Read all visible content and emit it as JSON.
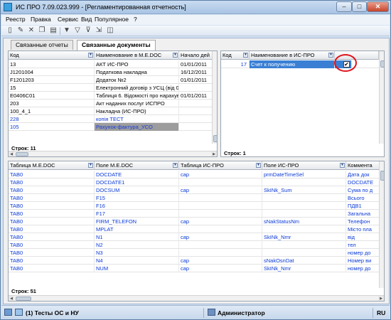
{
  "window": {
    "title": "ИС ПРО 7.09.023.999 - [Регламентированная отчетность]",
    "min_glyph": "–",
    "max_glyph": "□",
    "close_glyph": "✕"
  },
  "menu": [
    "Реестр",
    "Правка",
    "Сервис",
    "Вид",
    "Популярное",
    "?"
  ],
  "toolbar_icons": [
    "new-doc-icon",
    "edit-icon",
    "delete-icon",
    "copy-icon",
    "print-icon",
    "filter-icon",
    "filter-add-icon",
    "filter-remove-icon",
    "export-icon",
    "report-icon"
  ],
  "tabs": [
    {
      "label": "Связанные отчеты",
      "active": false
    },
    {
      "label": "Связанные документы",
      "active": true
    }
  ],
  "top_left_table": {
    "columns": [
      "Код",
      "Наименование в M.E.DOC",
      "Начало дей"
    ],
    "rows": [
      {
        "code": "13",
        "name": "АКТ ИС-ПРО",
        "start": "01/01/2011",
        "style": ""
      },
      {
        "code": "J1201004",
        "name": "Податкова накладна",
        "start": "16/12/2011",
        "style": ""
      },
      {
        "code": "F1201203",
        "name": "Додаток №2",
        "start": "01/01/2011",
        "style": ""
      },
      {
        "code": "15",
        "name": "Електронний договір з УСЦ (від 0...",
        "start": "",
        "style": ""
      },
      {
        "code": "E0406C01",
        "name": "Таблиця 6. Відомості про нарахув...",
        "start": "01/01/2011",
        "style": ""
      },
      {
        "code": "203",
        "name": "Акт наданих послуг ИСПРО",
        "start": "",
        "style": ""
      },
      {
        "code": "100_4_1",
        "name": "Накладна (ИС-ПРО)",
        "start": "",
        "style": ""
      },
      {
        "code": "228",
        "name": "копія ТЕСТ",
        "start": "",
        "style": "blue"
      },
      {
        "code": "105",
        "name": "Рахунок-фактура_УСО",
        "start": "",
        "style": "selected"
      }
    ],
    "footer": "Строк: 11"
  },
  "top_right_table": {
    "columns": [
      "Код",
      "Наименование в ИС-ПРО",
      ""
    ],
    "rows": [
      {
        "code": "17",
        "name": "Счет к получению",
        "checked": true,
        "check_glyph": "✔"
      }
    ],
    "footer": "Строк: 1"
  },
  "bottom_table": {
    "columns": [
      "Таблица M.E.DOC",
      "Поле M.E.DOC",
      "Таблица ИС-ПРО",
      "Поле ИС-ПРО",
      "Коммента"
    ],
    "rows": [
      {
        "t1": "TAB0",
        "f1": "DOCDATE",
        "t2": "cap",
        "f2": "prmDateTimeSel",
        "c": "Дата док"
      },
      {
        "t1": "TAB0",
        "f1": "DOCDATE1",
        "t2": "",
        "f2": "",
        "c": "DOCDATE"
      },
      {
        "t1": "TAB0",
        "f1": "DOCSUM",
        "t2": "cap",
        "f2": "SkINk_Sum",
        "c": "Сума по д"
      },
      {
        "t1": "TAB0",
        "f1": "F15",
        "t2": "",
        "f2": "",
        "c": "Всього"
      },
      {
        "t1": "TAB0",
        "f1": "F16",
        "t2": "",
        "f2": "",
        "c": "ПДВ1"
      },
      {
        "t1": "TAB0",
        "f1": "F17",
        "t2": "",
        "f2": "",
        "c": "Загальна"
      },
      {
        "t1": "TAB0",
        "f1": "FIRM_TELEFON",
        "t2": "cap",
        "f2": "sNakStatusNm",
        "c": "Телефон"
      },
      {
        "t1": "TAB0",
        "f1": "MPLAT",
        "t2": "",
        "f2": "",
        "c": "Місто пла"
      },
      {
        "t1": "TAB0",
        "f1": "N1",
        "t2": "cap",
        "f2": "SkINk_Nmr",
        "c": "від"
      },
      {
        "t1": "TAB0",
        "f1": "N2",
        "t2": "",
        "f2": "",
        "c": "тел"
      },
      {
        "t1": "TAB0",
        "f1": "N3",
        "t2": "",
        "f2": "",
        "c": "номер до"
      },
      {
        "t1": "TAB0",
        "f1": "N4",
        "t2": "cap",
        "f2": "sNakOsnDat",
        "c": "Номер ви"
      },
      {
        "t1": "TAB0",
        "f1": "NUM",
        "t2": "cap",
        "f2": "SkINk_Nmr",
        "c": "номер до"
      }
    ],
    "footer": "Строк: 51"
  },
  "statusbar": {
    "company": "(1) Тесты ОС и НУ",
    "user": "Администратор",
    "lang": "RU"
  }
}
